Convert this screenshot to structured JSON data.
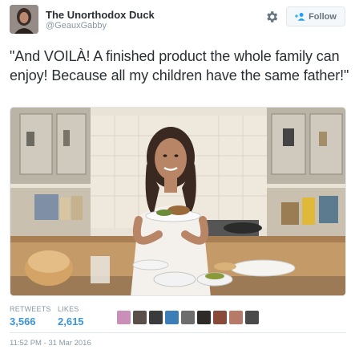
{
  "user": {
    "display_name": "The Unorthodox Duck",
    "handle": "@GeauxGabby"
  },
  "follow_button": {
    "label": "Follow"
  },
  "tweet": {
    "text": "\"And VOILÀ! A finished product the whole family can enjoy! Because all my children have the same father!\""
  },
  "stats": {
    "retweets_label": "RETWEETS",
    "retweets_count": "3,566",
    "likes_label": "LIKES",
    "likes_count": "2,615"
  },
  "liker_avatar_count": 9,
  "timestamp": "11:52 PM - 31 Mar 2016",
  "colors": {
    "link_blue": "#3b94d9",
    "muted_gray": "#8899a6",
    "text_dark": "#292f33",
    "border": "#e1e8ed"
  },
  "icons": {
    "gear": "gear-icon",
    "follow": "add-user-icon"
  }
}
